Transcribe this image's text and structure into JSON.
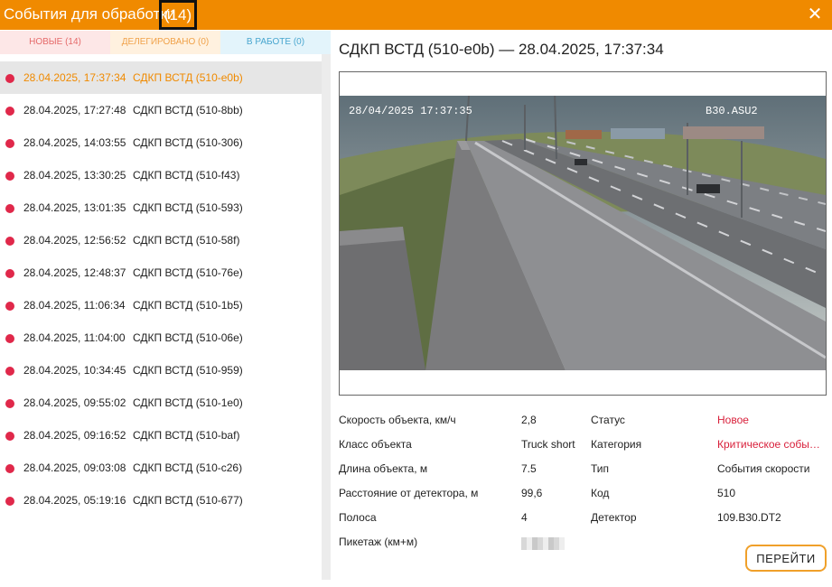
{
  "window": {
    "title": "События для обработки",
    "count": "(14)",
    "close_icon": "close-icon"
  },
  "tabs": [
    {
      "label": "НОВЫЕ (14)"
    },
    {
      "label": "ДЕЛЕГИРОВАНО (0)"
    },
    {
      "label": "В РАБОТЕ (0)"
    }
  ],
  "events": [
    {
      "datetime": "28.04.2025, 17:37:34",
      "name": "СДКП ВСТД (510-e0b)"
    },
    {
      "datetime": "28.04.2025, 17:27:48",
      "name": "СДКП ВСТД (510-8bb)"
    },
    {
      "datetime": "28.04.2025, 14:03:55",
      "name": "СДКП ВСТД (510-306)"
    },
    {
      "datetime": "28.04.2025, 13:30:25",
      "name": "СДКП ВСТД (510-f43)"
    },
    {
      "datetime": "28.04.2025, 13:01:35",
      "name": "СДКП ВСТД (510-593)"
    },
    {
      "datetime": "28.04.2025, 12:56:52",
      "name": "СДКП ВСТД (510-58f)"
    },
    {
      "datetime": "28.04.2025, 12:48:37",
      "name": "СДКП ВСТД (510-76e)"
    },
    {
      "datetime": "28.04.2025, 11:06:34",
      "name": "СДКП ВСТД (510-1b5)"
    },
    {
      "datetime": "28.04.2025, 11:04:00",
      "name": "СДКП ВСТД (510-06e)"
    },
    {
      "datetime": "28.04.2025, 10:34:45",
      "name": "СДКП ВСТД (510-959)"
    },
    {
      "datetime": "28.04.2025, 09:55:02",
      "name": "СДКП ВСТД (510-1e0)"
    },
    {
      "datetime": "28.04.2025, 09:16:52",
      "name": "СДКП ВСТД (510-baf)"
    },
    {
      "datetime": "28.04.2025, 09:03:08",
      "name": "СДКП ВСТД (510-c26)"
    },
    {
      "datetime": "28.04.2025, 05:19:16",
      "name": "СДКП ВСТД (510-677)"
    }
  ],
  "detail": {
    "title": "СДКП ВСТД (510-e0b) — 28.04.2025, 17:37:34",
    "camera": {
      "timestamp_overlay": "28/04/2025 17:37:35",
      "camera_id_overlay": "B30.ASU2"
    },
    "properties_left": [
      {
        "label": "Скорость объекта, км/ч",
        "value": "2,8"
      },
      {
        "label": "Класс объекта",
        "value": "Truck short"
      },
      {
        "label": "Длина объекта, м",
        "value": "7.5"
      },
      {
        "label": "Расстояние от детектора, м",
        "value": "99,6"
      },
      {
        "label": "Полоса",
        "value": "4"
      },
      {
        "label": "Пикетаж (км+м)",
        "value": ""
      }
    ],
    "properties_right": [
      {
        "label": "Статус",
        "value": "Новое"
      },
      {
        "label": "Категория",
        "value": "Критическое событие"
      },
      {
        "label": "Тип",
        "value": "События скорости"
      },
      {
        "label": "Код",
        "value": "510"
      },
      {
        "label": "Детектор",
        "value": "109.B30.DT2"
      }
    ],
    "go_button": "ПЕРЕЙТИ",
    "colors": {
      "accent": "#f08a00",
      "status_red": "#d81f3a",
      "event_dot": "#e0284a"
    }
  }
}
